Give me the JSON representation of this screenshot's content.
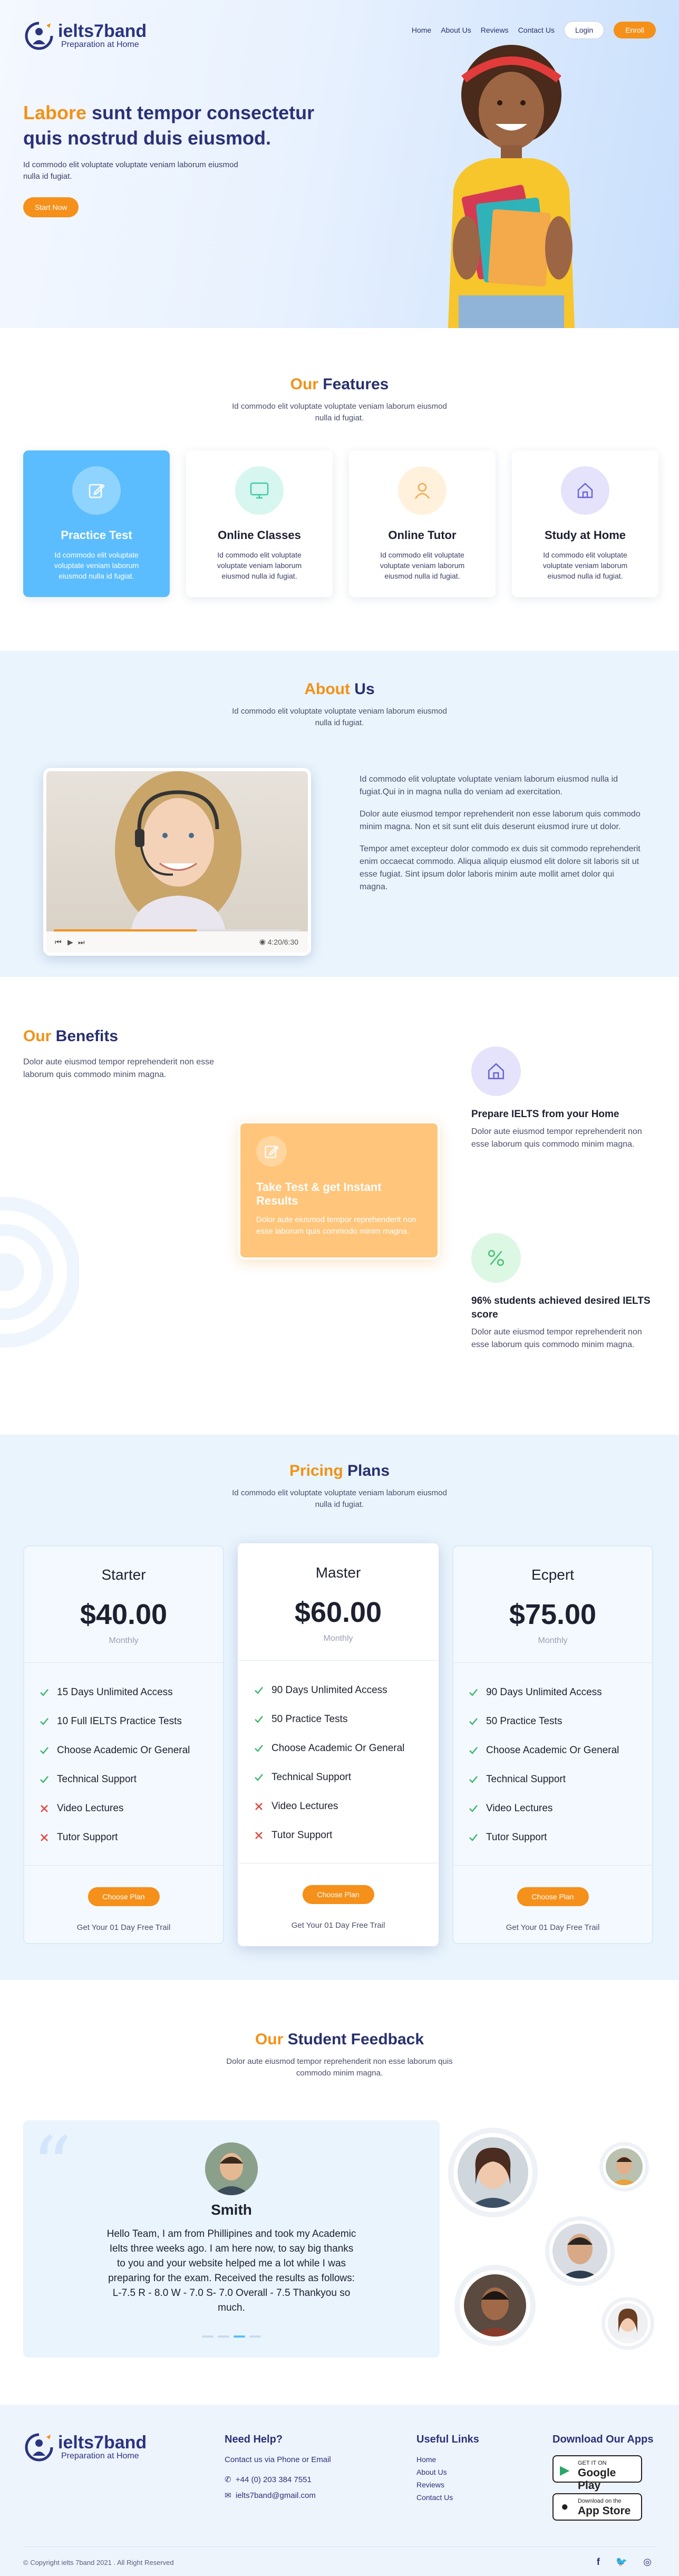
{
  "brand": {
    "name": "ielts7band",
    "tagline": "Preparation at Home"
  },
  "nav": {
    "items": [
      "Home",
      "About Us",
      "Reviews",
      "Contact Us"
    ],
    "login": "Login",
    "enroll": "Enroll"
  },
  "hero": {
    "title_accent": "Labore",
    "title_rest": " sunt tempor consectetur quis nostrud duis eiusmod.",
    "subtitle": "Id commodo elit voluptate voluptate veniam laborum eiusmod nulla id fugiat.",
    "cta": "Start Now"
  },
  "features": {
    "title_accent": "Our",
    "title_rest": " Features",
    "subtitle": "Id commodo elit voluptate voluptate veniam laborum eiusmod nulla id fugiat.",
    "cards": [
      {
        "title": "Practice Test",
        "text": "Id commodo elit voluptate voluptate veniam laborum eiusmod nulla id fugiat."
      },
      {
        "title": "Online Classes",
        "text": "Id commodo elit voluptate voluptate veniam laborum eiusmod nulla id fugiat."
      },
      {
        "title": "Online Tutor",
        "text": "Id commodo elit voluptate voluptate veniam laborum eiusmod nulla id fugiat."
      },
      {
        "title": "Study at Home",
        "text": "Id commodo elit voluptate voluptate veniam laborum eiusmod nulla id fugiat."
      }
    ]
  },
  "about": {
    "title_accent": "About",
    "title_rest": " Us",
    "subtitle": "Id commodo elit voluptate voluptate veniam laborum eiusmod nulla id fugiat.",
    "video_time": "4:20/6:30",
    "video_progress": 0.58,
    "paragraphs": [
      "Id commodo elit voluptate voluptate veniam laborum eiusmod nulla id fugiat.Qui in in magna nulla do veniam ad exercitation.",
      "Dolor aute eiusmod tempor reprehenderit non esse laborum quis commodo minim magna. Non et sit sunt elit duis deserunt eiusmod irure ut dolor.",
      "Tempor amet excepteur dolor commodo ex duis sit commodo reprehenderit enim occaecat commodo. Aliqua aliquip eiusmod elit dolore sit laboris sit ut esse fugiat. Sint ipsum dolor laboris minim aute mollit amet dolor qui magna."
    ]
  },
  "benefits": {
    "title_accent": "Our",
    "title_rest": " Benefits",
    "subtitle": "Dolor aute eiusmod tempor reprehenderit non esse laborum quis commodo minim magna.",
    "highlight": {
      "title": "Take Test & get Instant Results",
      "text": "Dolor aute eiusmod tempor reprehenderit non esse laborum quis commodo minim magna."
    },
    "items": [
      {
        "title": "Prepare IELTS from your Home",
        "text": "Dolor aute eiusmod tempor reprehenderit non esse laborum quis commodo minim magna."
      },
      {
        "title": "96% students achieved desired IELTS score",
        "text": "Dolor aute eiusmod tempor reprehenderit non esse laborum quis commodo minim magna."
      }
    ]
  },
  "pricing": {
    "title_accent": "Pricing",
    "title_rest": " Plans",
    "subtitle": "Id commodo elit voluptate voluptate veniam laborum eiusmod nulla id fugiat.",
    "choose_label": "Choose Plan",
    "trail_label": "Get Your 01 Day Free Trail",
    "plans": [
      {
        "name": "Starter",
        "price": "$40.00",
        "period": "Monthly",
        "features": [
          {
            "text": "15 Days Unlimited Access",
            "ok": true
          },
          {
            "text": "10 Full IELTS Practice Tests",
            "ok": true
          },
          {
            "text": "Choose Academic Or General",
            "ok": true
          },
          {
            "text": "Technical Support",
            "ok": true
          },
          {
            "text": "Video Lectures",
            "ok": false
          },
          {
            "text": "Tutor Support",
            "ok": false
          }
        ]
      },
      {
        "name": "Master",
        "price": "$60.00",
        "period": "Monthly",
        "features": [
          {
            "text": "90 Days Unlimited Access",
            "ok": true
          },
          {
            "text": "50 Practice Tests",
            "ok": true
          },
          {
            "text": "Choose Academic Or General",
            "ok": true
          },
          {
            "text": "Technical Support",
            "ok": true
          },
          {
            "text": "Video Lectures",
            "ok": false
          },
          {
            "text": "Tutor Support",
            "ok": false
          }
        ]
      },
      {
        "name": "Ecpert",
        "price": "$75.00",
        "period": "Monthly",
        "features": [
          {
            "text": "90 Days Unlimited Access",
            "ok": true
          },
          {
            "text": "50 Practice Tests",
            "ok": true
          },
          {
            "text": "Choose Academic Or General",
            "ok": true
          },
          {
            "text": "Technical Support",
            "ok": true
          },
          {
            "text": "Video Lectures",
            "ok": true
          },
          {
            "text": "Tutor Support",
            "ok": true
          }
        ]
      }
    ]
  },
  "feedback": {
    "title_accent": "Our",
    "title_rest": " Student Feedback",
    "subtitle": "Dolor aute eiusmod tempor reprehenderit non esse laborum quis commodo minim magna.",
    "name": "Smith",
    "text": "Hello Team, I am from Phillipines and took my Academic Ielts three weeks ago. I am here now, to say big thanks to you and your website helped me a lot while I was preparing for the exam. Received the results as follows: L-7.5 R - 8.0 W - 7.0 S- 7.0 Overall - 7.5 Thankyou so much."
  },
  "footer": {
    "help_title": "Need Help?",
    "help_text": "Contact us via Phone or Email",
    "phone": "+44 (0) 203 384 7551",
    "email": "ielts7band@gmail.com",
    "links_title": "Useful Links",
    "links": [
      "Home",
      "About Us",
      "Reviews",
      "Contact Us"
    ],
    "apps_title": "Download Our Apps",
    "google_small": "GET IT ON",
    "google_big": "Google Play",
    "apple_small": "Download on the",
    "apple_big": "App Store",
    "copyright": "© Copyright ielts 7band 2021 . All Right Reserved"
  },
  "colors": {
    "accent": "#f29116",
    "navy": "#29306e",
    "sky": "#5bbdfd",
    "peach": "#ffc57a"
  }
}
